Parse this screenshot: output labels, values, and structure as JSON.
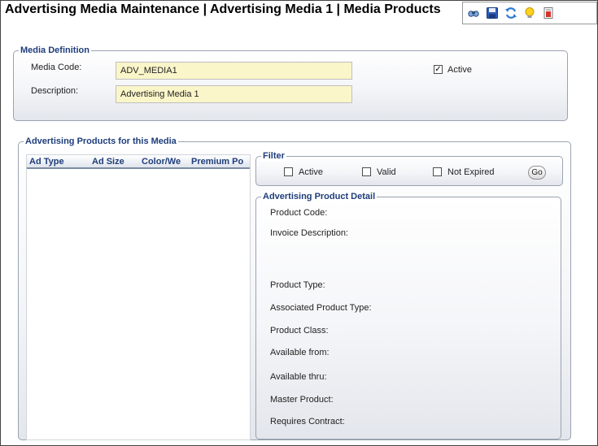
{
  "page": {
    "title": "Advertising Media Maintenance | Advertising Media 1 | Media Products"
  },
  "toolbar": {
    "buttons": [
      {
        "name": "search-icon"
      },
      {
        "name": "save-icon"
      },
      {
        "name": "refresh-icon"
      },
      {
        "name": "lightbulb-icon"
      },
      {
        "name": "report-icon"
      }
    ]
  },
  "media_definition": {
    "legend": "Media Definition",
    "media_code_label": "Media Code:",
    "media_code_value": "ADV_MEDIA1",
    "description_label": "Description:",
    "description_value": "Advertising Media 1",
    "active_label": "Active",
    "active_checked": true,
    "active_mark": "✓"
  },
  "products": {
    "legend": "Advertising Products for this Media",
    "columns": [
      "Ad Type",
      "Ad Size",
      "Color/We",
      "Premium Po"
    ],
    "rows": []
  },
  "filter": {
    "legend": "Filter",
    "active_label": "Active",
    "valid_label": "Valid",
    "not_expired_label": "Not Expired",
    "go_label": "Go"
  },
  "detail": {
    "legend": "Advertising Product Detail",
    "product_code": "Product Code:",
    "invoice_description": "Invoice Description:",
    "product_type": "Product Type:",
    "associated_product_type": "Associated Product Type:",
    "product_class": "Product Class:",
    "available_from": "Available from:",
    "available_thru": "Available thru:",
    "master_product": "Master Product:",
    "requires_contract": "Requires Contract:"
  },
  "colors": {
    "legend_text": "#1e3d7b",
    "input_bg": "#fbf6c9",
    "group_border": "#9aa3b0"
  }
}
